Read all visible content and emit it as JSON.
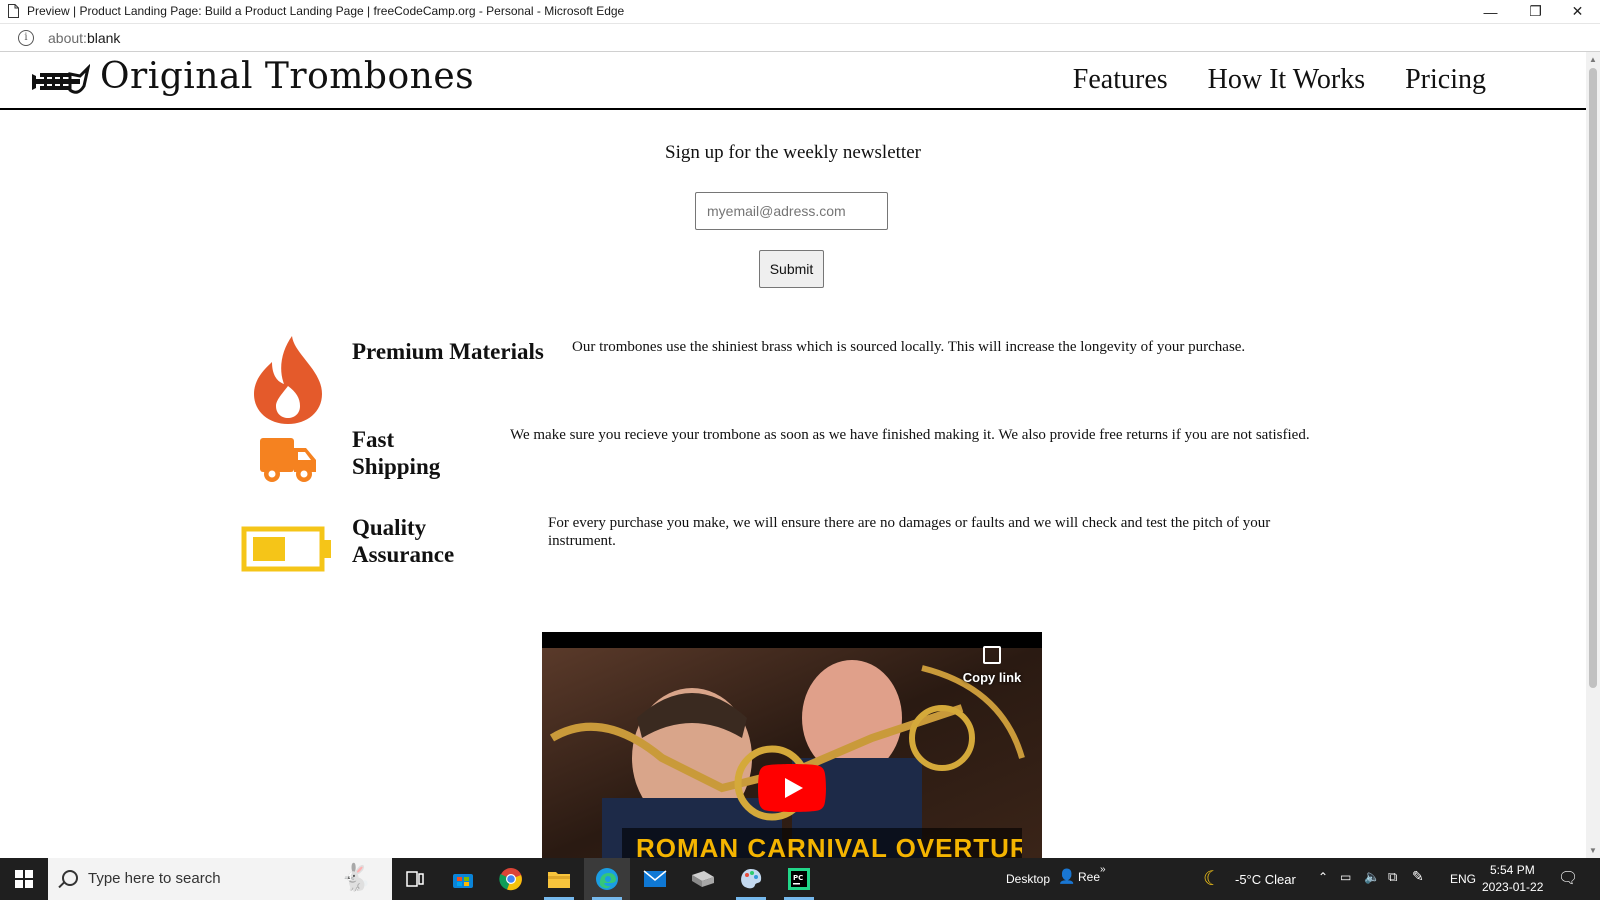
{
  "window": {
    "title": "Preview | Product Landing Page: Build a Product Landing Page | freeCodeCamp.org - Personal - Microsoft Edge",
    "minimize": "—",
    "restore": "❐",
    "close": "✕"
  },
  "address": {
    "scheme": "about:",
    "path": "blank"
  },
  "site": {
    "logo_text": "Original Trombones",
    "nav": [
      "Features",
      "How It Works",
      "Pricing"
    ]
  },
  "newsletter": {
    "title": "Sign up for the weekly newsletter",
    "placeholder": "myemail@adress.com",
    "submit_label": "Submit"
  },
  "features": [
    {
      "title": "Premium Materials",
      "desc": "Our trombones use the shiniest brass which is sourced locally. This will increase the longevity of your purchase.",
      "icon": "fire-icon",
      "color": "#e45a2b"
    },
    {
      "title": "Fast Shipping",
      "desc": "We make sure you recieve your trombone as soon as we have finished making it. We also provide free returns if you are not satisfied.",
      "icon": "truck-icon",
      "color": "#f58220"
    },
    {
      "title": "Quality Assurance",
      "desc": "For every purchase you make, we will ensure there are no damages or faults and we will check and test the pitch of your instrument.",
      "icon": "battery-icon",
      "color": "#f5c518"
    }
  ],
  "video": {
    "copy_link": "Copy link",
    "caption": "ROMAN CARNIVAL OVERTURE"
  },
  "taskbar": {
    "search_placeholder": "Type here to search",
    "desktop_label": "Desktop",
    "user_label": "Ree",
    "weather": "-5°C  Clear",
    "lang": "ENG",
    "time": "5:54 PM",
    "date": "2023-01-22"
  }
}
